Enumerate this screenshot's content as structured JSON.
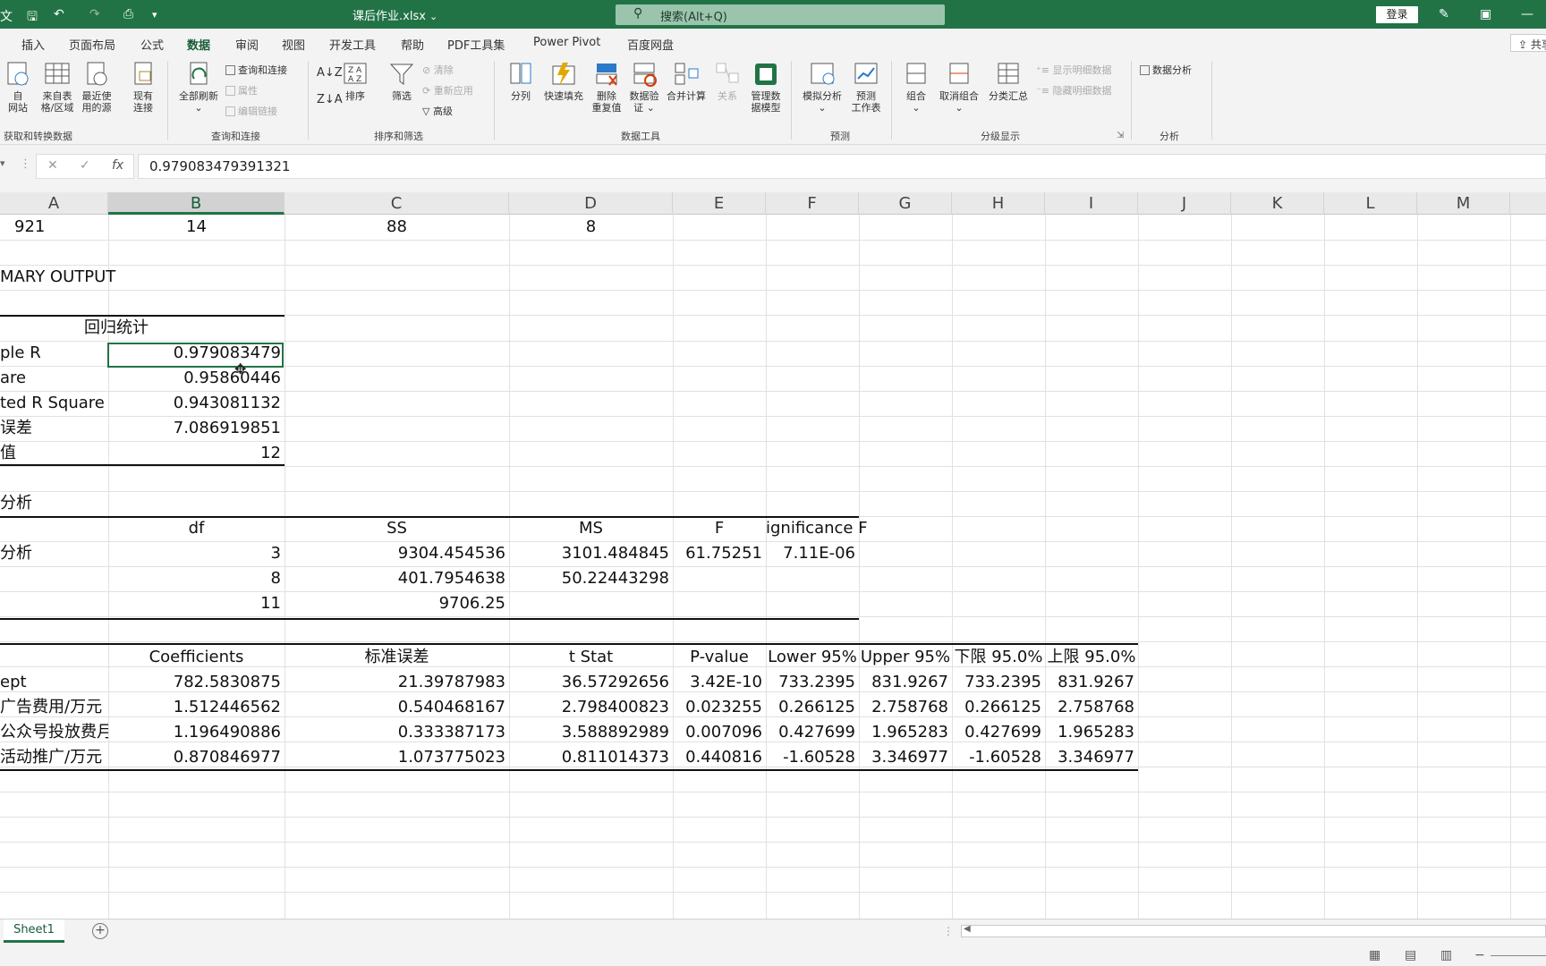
{
  "titlebar": {
    "app_badge": "文",
    "filename": "课后作业.xlsx",
    "filename_caret": "⌄",
    "search_text": "搜索(Alt+Q)",
    "login": "登录"
  },
  "tabs": [
    "插入",
    "页面布局",
    "公式",
    "数据",
    "审阅",
    "视图",
    "开发工具",
    "帮助",
    "PDF工具集",
    "Power Pivot",
    "百度网盘"
  ],
  "active_tab": "数据",
  "share_label": "共享",
  "ribbon": {
    "get_data": {
      "b1": "自\n网站",
      "b2": "来自表\n格/区域",
      "b3": "最近使\n用的源",
      "b4": "现有\n连接",
      "label": "获取和转换数据"
    },
    "queries": {
      "refresh": "全部刷新",
      "queries_conn": "查询和连接",
      "properties": "属性",
      "edit_links": "编辑链接",
      "label": "查询和连接"
    },
    "sort_filter": {
      "sort": "排序",
      "filter": "筛选",
      "clear": "清除",
      "reapply": "重新应用",
      "advanced": "高级",
      "label": "排序和筛选"
    },
    "data_tools": {
      "split": "分列",
      "flash_fill": "快速填充",
      "remove_dup": "删除\n重复值",
      "validation": "数据验\n证 ⌄",
      "consolidate": "合并计算",
      "relations": "关系",
      "manage_model": "管理数\n据模型",
      "label": "数据工具"
    },
    "forecast": {
      "whatif": "模拟分析\n⌄",
      "forecast_sheet": "预测\n工作表",
      "label": "预测"
    },
    "outline": {
      "group": "组合\n⌄",
      "ungroup": "取消组合\n⌄",
      "subtotal": "分类汇总",
      "show_detail": "显示明细数据",
      "hide_detail": "隐藏明细数据",
      "label": "分级显示"
    },
    "analysis": {
      "data_analysis": "数据分析",
      "label": "分析"
    }
  },
  "formula_bar": {
    "value": "0.979083479391321"
  },
  "columns": [
    "A",
    "B",
    "C",
    "D",
    "E",
    "F",
    "G",
    "H",
    "I",
    "J",
    "K",
    "L",
    "M"
  ],
  "selected_column": "B",
  "sheet": {
    "row1": [
      "921",
      "14",
      "88",
      "8"
    ],
    "summary_output": "MARY OUTPUT",
    "regression_stats_title": "回归统计",
    "stats": [
      {
        "label": "ple R",
        "value": "0.979083479"
      },
      {
        "label": "are",
        "value": "0.95860446"
      },
      {
        "label": "ted R Square",
        "value": "0.943081132"
      },
      {
        "label": "误差",
        "value": "7.086919851"
      },
      {
        "label": "值",
        "value": "12"
      }
    ],
    "anova_title": "分析",
    "anova_headers": [
      "df",
      "SS",
      "MS",
      "F",
      "ignificance F"
    ],
    "anova_rows": [
      {
        "label": "分析",
        "df": "3",
        "ss": "9304.454536",
        "ms": "3101.484845",
        "f": "61.75251",
        "sig": "7.11E-06"
      },
      {
        "label": "",
        "df": "8",
        "ss": "401.7954638",
        "ms": "50.22443298",
        "f": "",
        "sig": ""
      },
      {
        "label": "",
        "df": "11",
        "ss": "9706.25",
        "ms": "",
        "f": "",
        "sig": ""
      }
    ],
    "coef_headers": [
      "Coefficients",
      "标准误差",
      "t Stat",
      "P-value",
      "Lower 95%",
      "Upper 95%",
      "下限 95.0%",
      "上限 95.0%"
    ],
    "coef_rows": [
      {
        "label": "ept",
        "vals": [
          "782.5830875",
          "21.39787983",
          "36.57292656",
          "3.42E-10",
          "733.2395",
          "831.9267",
          "733.2395",
          "831.9267"
        ]
      },
      {
        "label": "广告费用/万元",
        "vals": [
          "1.512446562",
          "0.540468167",
          "2.798400823",
          "0.023255",
          "0.266125",
          "2.758768",
          "0.266125",
          "2.758768"
        ]
      },
      {
        "label": "公众号投放费月",
        "vals": [
          "1.196490886",
          "0.333387173",
          "3.588892989",
          "0.007096",
          "0.427699",
          "1.965283",
          "0.427699",
          "1.965283"
        ]
      },
      {
        "label": "活动推广/万元",
        "vals": [
          "0.870846977",
          "1.073775023",
          "0.811014373",
          "0.440816",
          "-1.60528",
          "3.346977",
          "-1.60528",
          "3.346977"
        ]
      }
    ]
  },
  "sheet_tab": "Sheet1",
  "add_sheet": "+"
}
